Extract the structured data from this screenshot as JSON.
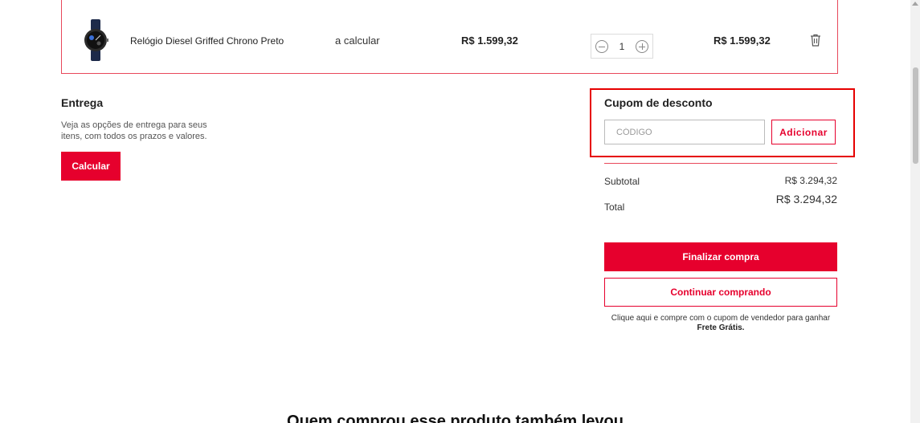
{
  "cart": {
    "item": {
      "name": "Relógio Diesel Griffed Chrono Preto",
      "image_icon": "watch-icon",
      "shipping": "a calcular",
      "unit_price": "R$ 1.599,32",
      "quantity": "1",
      "total": "R$ 1.599,32"
    }
  },
  "delivery": {
    "title": "Entrega",
    "description": "Veja as opções de entrega para seus itens, com todos os prazos e valores.",
    "button": "Calcular"
  },
  "coupon": {
    "title": "Cupom de desconto",
    "placeholder": "CÓDIGO",
    "value": "",
    "button": "Adicionar"
  },
  "summary": {
    "subtotal_label": "Subtotal",
    "subtotal_value": "R$ 3.294,32",
    "total_label": "Total",
    "total_value": "R$ 3.294,32"
  },
  "actions": {
    "finalize": "Finalizar compra",
    "continue": "Continuar comprando",
    "vendor_note_prefix": "Clique aqui e compre com o cupom de vendedor para ganhar ",
    "vendor_note_bold": "Frete Grátis."
  },
  "recommendations": {
    "title": "Quem comprou esse produto também levou"
  },
  "colors": {
    "accent": "#e6002d",
    "highlight_border": "#e60000"
  }
}
